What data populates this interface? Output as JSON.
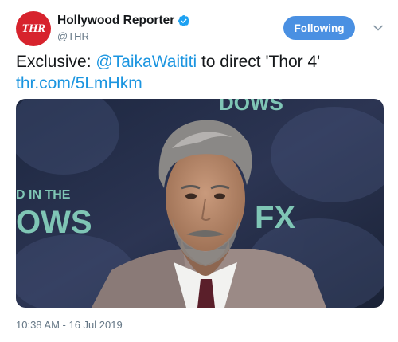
{
  "account": {
    "avatar_text": "THR",
    "display_name": "Hollywood Reporter",
    "handle": "@THR",
    "verified": true
  },
  "follow_button": {
    "label": "Following",
    "color": "#4a90e2"
  },
  "tweet": {
    "prefix": "Exclusive: ",
    "mention": "@TaikaWaititi",
    "suffix": " to direct 'Thor 4'",
    "link": "thr.com/5LmHkm"
  },
  "media": {
    "backdrop_text_top": "DOWS",
    "backdrop_text_left_1": "D IN THE",
    "backdrop_text_left_2": "OWS",
    "backdrop_logo": "FX"
  },
  "timestamp": "10:38 AM - 16 Jul 2019",
  "icons": {
    "more": "chevron-down-icon",
    "verified": "verified-badge-icon"
  },
  "colors": {
    "link": "#1b95e0",
    "brand_red": "#d7232d"
  }
}
